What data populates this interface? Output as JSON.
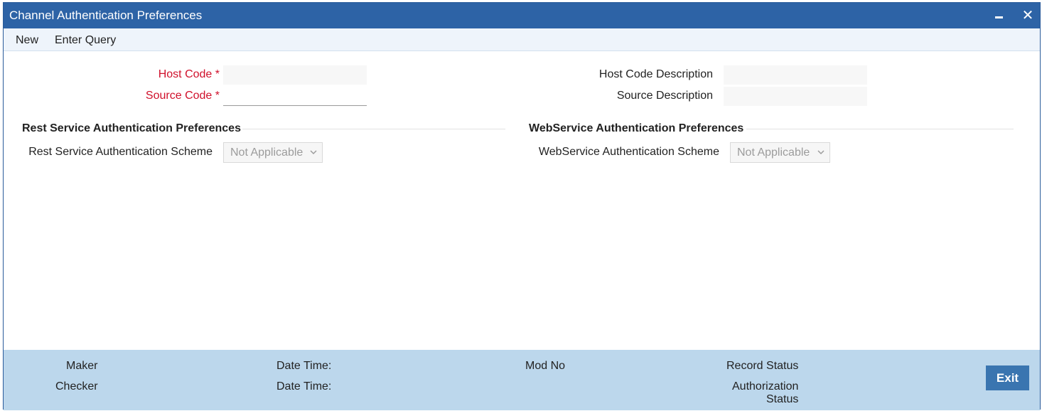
{
  "window": {
    "title": "Channel Authentication Preferences",
    "minimize_icon": "minimize-icon",
    "close_icon": "close-icon"
  },
  "menu": {
    "new_label": "New",
    "enter_query_label": "Enter Query"
  },
  "form": {
    "host_code_label": "Host Code",
    "host_code_value": "",
    "source_code_label": "Source Code",
    "source_code_value": "",
    "required_marker": "*",
    "host_code_description_label": "Host Code Description",
    "host_code_description_value": "",
    "source_description_label": "Source Description",
    "source_description_value": ""
  },
  "rest_section": {
    "title": "Rest Service Authentication Preferences",
    "scheme_label": "Rest Service Authentication Scheme",
    "scheme_value": "Not Applicable"
  },
  "webservice_section": {
    "title": "WebService Authentication Preferences",
    "scheme_label": "WebService Authentication Scheme",
    "scheme_value": "Not Applicable"
  },
  "footer": {
    "maker_label": "Maker",
    "checker_label": "Checker",
    "date_time_label_1": "Date Time:",
    "date_time_label_2": "Date Time:",
    "mod_no_label": "Mod No",
    "record_status_label": "Record Status",
    "authorization_label": "Authorization",
    "status_label": "Status",
    "exit_label": "Exit"
  },
  "colors": {
    "title_bar": "#2d63a6",
    "required": "#d0102b",
    "footer": "#bcd7ec",
    "exit_button": "#3a75b0"
  }
}
